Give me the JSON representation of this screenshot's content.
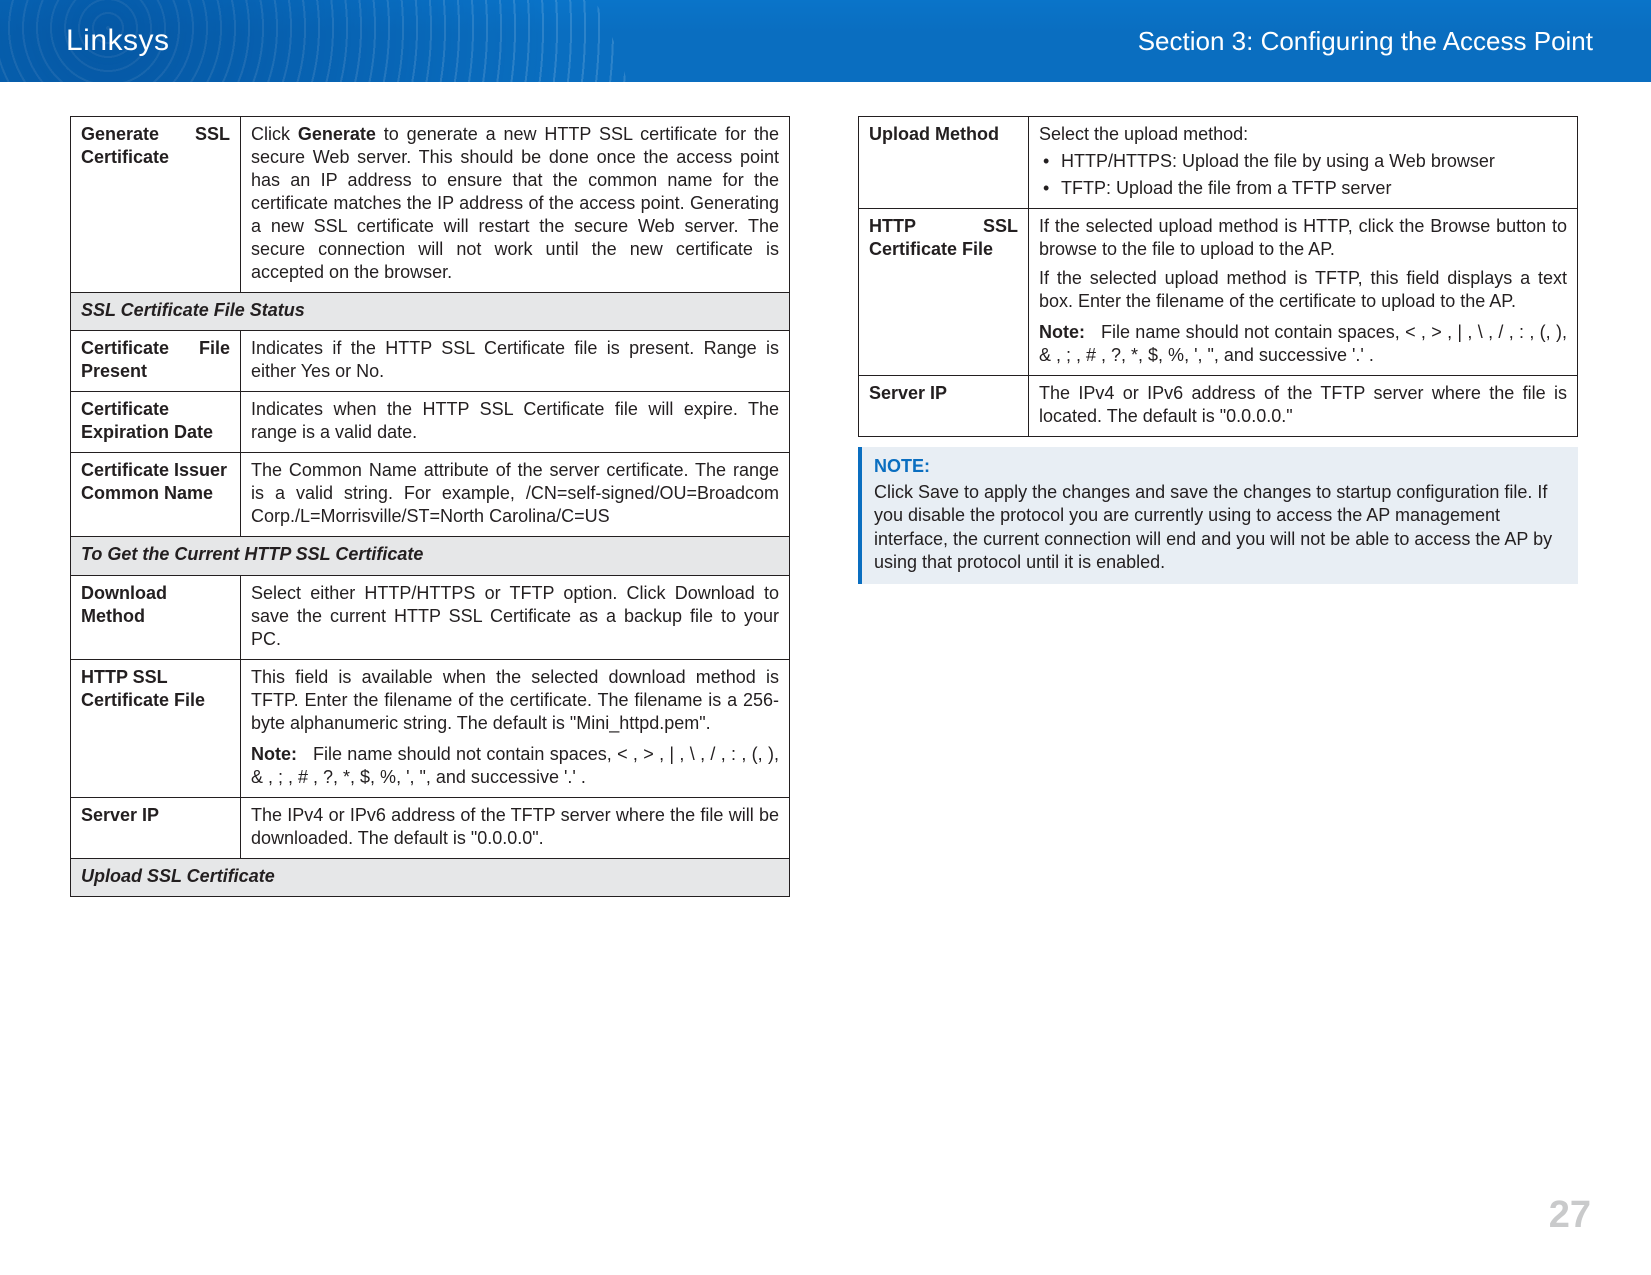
{
  "header": {
    "brand": "Linksys",
    "section": "Section 3:  Configuring the Access Point"
  },
  "page_number": "27",
  "left_table": {
    "rows": [
      {
        "label_parts": [
          "Generate",
          "SSL",
          "Certificate"
        ],
        "desc": "Click Generate to generate a new HTTP SSL certificate for the secure Web server. This should be done once the access point has an IP address to ensure that the common name for the certificate matches the IP address of the access point. Generating a new SSL certificate will restart the secure Web server. The secure connection will not work until the new certificate is accepted on the browser.",
        "bold_word": "Generate"
      }
    ],
    "section1": "SSL Certificate File Status",
    "rows2": [
      {
        "label_parts": [
          "Certificate",
          "File",
          "Present"
        ],
        "desc": "Indicates if the HTTP SSL Certificate file is present. Range is either Yes or No."
      },
      {
        "label": "Certificate Expiration Date",
        "desc": "Indicates when the HTTP SSL Certificate file will expire. The range is a valid date."
      },
      {
        "label": "Certificate Issuer Common Name",
        "desc": "The Common Name attribute of the server certificate. The range is a valid string. For example, /CN=self-signed/OU=Broadcom Corp./L=Morrisville/ST=North Carolina/C=US"
      }
    ],
    "section2": "To Get the Current HTTP SSL Certificate",
    "rows3": [
      {
        "label": "Download Method",
        "desc": "Select either HTTP/HTTPS or TFTP option. Click Download to save the current HTTP SSL Certificate as a backup file to your PC."
      },
      {
        "label": "HTTP SSL Certificate File",
        "desc": "This field is available when the selected download method is TFTP. Enter the filename of the certificate. The filename is a 256-byte alphanumeric string. The default is \"Mini_httpd.pem\".",
        "note": "File name should not contain spaces, < , > , | , \\ , / , : , (, ), & , ; , # , ?, *, $, %, ', \", and successive '.' ."
      },
      {
        "label": "Server IP",
        "desc": "The IPv4 or IPv6 address of the TFTP server where the file will be downloaded. The default is \"0.0.0.0\"."
      }
    ],
    "section3": "Upload SSL Certificate"
  },
  "right_table": {
    "rows": [
      {
        "label": "Upload Method",
        "intro": "Select the upload method:",
        "bullets": [
          "HTTP/HTTPS: Upload the file by using a Web browser",
          "TFTP: Upload the file from a TFTP server"
        ]
      },
      {
        "label_parts": [
          "HTTP",
          "SSL",
          "Certificate File"
        ],
        "desc1": "If the selected upload method is HTTP, click the Browse button to browse to the file to upload to the AP.",
        "desc2": "If the selected upload method is TFTP, this field displays a text box. Enter the filename of the certificate to upload to the AP.",
        "note": "File name should not contain spaces, < , > , | , \\ , / , : , (, ), & , ; , # , ?, *, $, %, ', \", and successive '.' ."
      },
      {
        "label": "Server IP",
        "desc": "The IPv4 or IPv6 address of the TFTP server where the file is located. The default is \"0.0.0.0.\""
      }
    ]
  },
  "note_box": {
    "heading": "NOTE:",
    "body": "Click Save to apply the changes and save the changes to startup configuration file. If you disable the protocol you are currently using to access the AP management interface, the current connection will end and you will not be able to access the AP by using that protocol until it is enabled."
  },
  "labels": {
    "note": "Note:"
  }
}
